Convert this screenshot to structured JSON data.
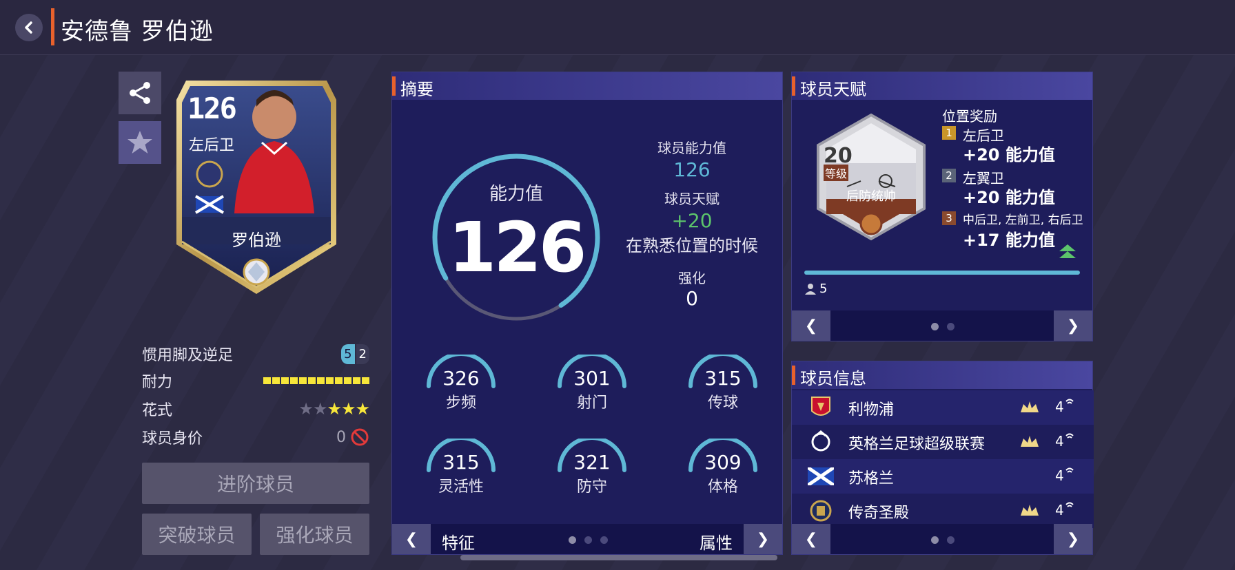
{
  "header": {
    "title": "安德鲁 罗伯逊"
  },
  "card": {
    "rating": "126",
    "position": "左后卫",
    "name": "罗伯逊"
  },
  "left_stats": {
    "foot_label": "惯用脚及逆足",
    "foot_strong": "5",
    "foot_weak": "2",
    "stamina_label": "耐力",
    "stamina_level": 1.0,
    "skill_label": "花式",
    "skill_stars": 3,
    "skill_stars_max": 5,
    "value_label": "球员身价",
    "value": "0"
  },
  "buttons": {
    "advance": "进阶球员",
    "breakthrough": "突破球员",
    "strengthen": "强化球员"
  },
  "summary": {
    "title": "摘要",
    "ability_label": "能力值",
    "ability_value": "126",
    "ring_fraction": 0.74,
    "player_ability_label": "球员能力值",
    "player_ability_value": "126",
    "talent_label": "球员天赋",
    "talent_value": "+20",
    "talent_note": "在熟悉位置的时候",
    "enhance_label": "强化",
    "enhance_value": "0",
    "attributes": [
      {
        "value": "326",
        "label": "步频"
      },
      {
        "value": "301",
        "label": "射门"
      },
      {
        "value": "315",
        "label": "传球"
      },
      {
        "value": "315",
        "label": "灵活性"
      },
      {
        "value": "321",
        "label": "防守"
      },
      {
        "value": "309",
        "label": "体格"
      }
    ],
    "footer_left": "特征",
    "footer_right": "属性"
  },
  "talent": {
    "title": "球员天赋",
    "level": "20",
    "level_label": "等级",
    "badge_name": "后防统帅",
    "bonus_title": "位置奖励",
    "bonuses": [
      {
        "rank": "1",
        "position": "左后卫",
        "bonus": "+20 能力值",
        "color": "#c8952a"
      },
      {
        "rank": "2",
        "position": "左翼卫",
        "bonus": "+20 能力值",
        "color": "#5b6478"
      },
      {
        "rank": "3",
        "position": "中后卫, 左前卫, 右后卫",
        "bonus": "+17 能力值",
        "color": "#8a4a2e"
      }
    ],
    "count": "5"
  },
  "info": {
    "title": "球员信息",
    "rows": [
      {
        "name": "利物浦",
        "level": "4",
        "icon": "liverpool-crest-icon"
      },
      {
        "name": "英格兰足球超级联赛",
        "level": "4",
        "icon": "premier-league-icon"
      },
      {
        "name": "苏格兰",
        "level": "4",
        "icon": "scotland-flag-icon"
      },
      {
        "name": "传奇圣殿",
        "level": "4",
        "icon": "legend-hall-icon"
      }
    ]
  },
  "colors": {
    "accent": "#e8612c",
    "teal": "#5fb8d6",
    "green": "#5cc46b",
    "star": "#f7e63a"
  }
}
